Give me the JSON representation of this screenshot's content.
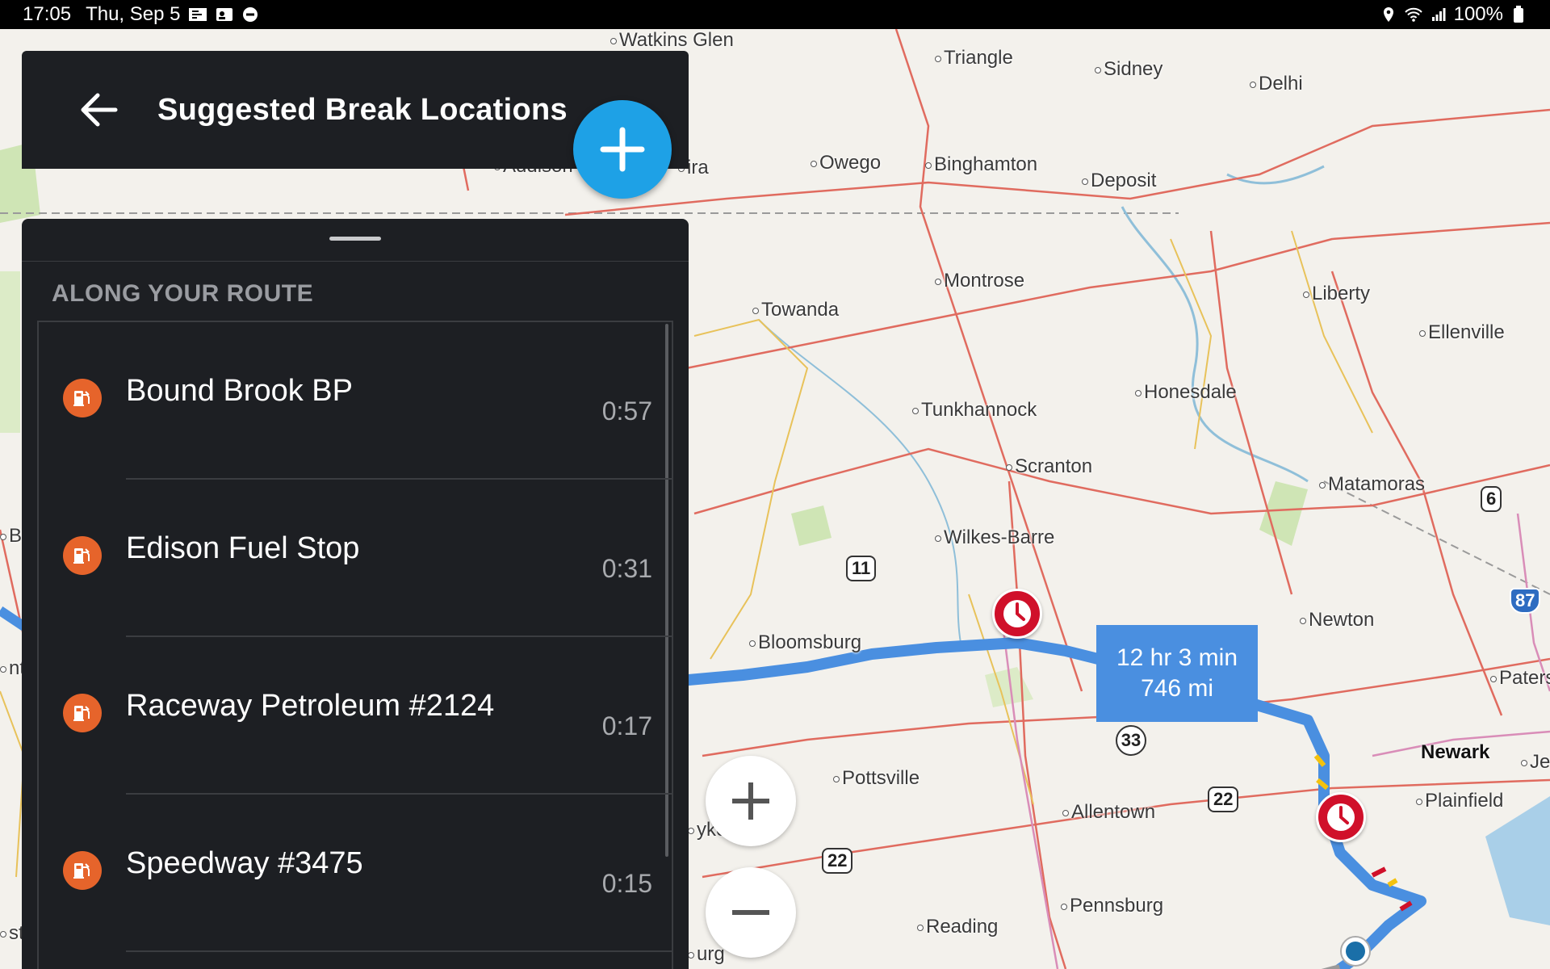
{
  "status_bar": {
    "time": "17:05",
    "date": "Thu, Sep 5",
    "battery": "100%"
  },
  "header": {
    "title": "Suggested Break Locations"
  },
  "sheet": {
    "section_title": "ALONG YOUR ROUTE",
    "items": [
      {
        "name": "Bound Brook BP",
        "time": "0:57",
        "icon": "fuel-station-icon"
      },
      {
        "name": "Edison Fuel Stop",
        "time": "0:31",
        "icon": "fuel-station-icon"
      },
      {
        "name": "Raceway Petroleum #2124",
        "time": "0:17",
        "icon": "fuel-station-icon"
      },
      {
        "name": "Speedway #3475",
        "time": "0:15",
        "icon": "fuel-station-icon"
      }
    ]
  },
  "route": {
    "duration": "12 hr 3 min",
    "distance": "746 mi"
  },
  "map": {
    "cities": [
      "Watkins Glen",
      "Triangle",
      "Sidney",
      "Delhi",
      "Owego",
      "Binghamton",
      "Deposit",
      "Montrose",
      "Towanda",
      "Liberty",
      "Ellenville",
      "Honesdale",
      "Tunkhannock",
      "Scranton",
      "Matamoras",
      "Wilkes-Barre",
      "Bloomsburg",
      "Newton",
      "Pottsville",
      "Allentown",
      "Plainfield",
      "Pennsburg",
      "Reading",
      "Newark",
      "Paters",
      "Je",
      "ira",
      "Addison",
      "yke",
      "urg",
      "Bro",
      "sto",
      "nta"
    ],
    "shields": [
      "11",
      "33",
      "22",
      "22",
      "6",
      "87"
    ]
  },
  "colors": {
    "accent": "#1ea1e6",
    "panel": "#1d1f23",
    "fuel": "#e6642b",
    "break_pin": "#d0102a",
    "route": "#4a8fe0"
  }
}
